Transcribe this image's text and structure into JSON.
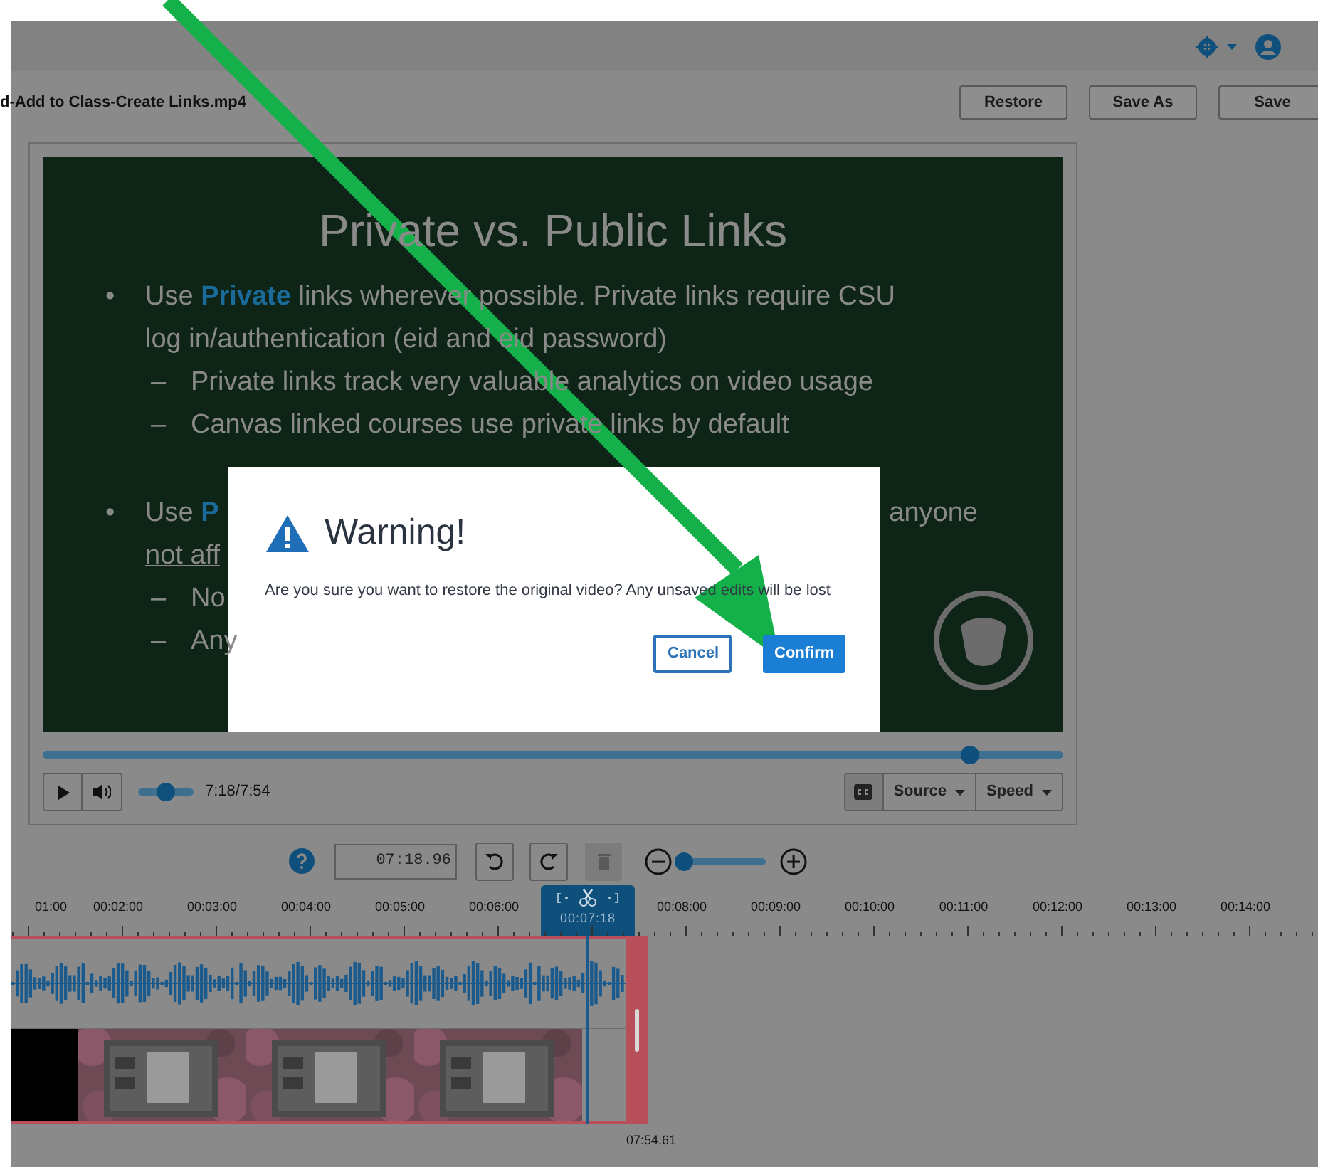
{
  "file": {
    "name": "d-Add to Class-Create Links.mp4"
  },
  "actions": [
    {
      "label": "Restore"
    },
    {
      "label": "Save As"
    },
    {
      "label": "Save"
    }
  ],
  "slide": {
    "title": "Private vs. Public Links",
    "bullets": [
      {
        "kind": "bullet",
        "marker": "•",
        "segments": [
          {
            "text": "Use "
          },
          {
            "text": "Private",
            "highlight": true
          },
          {
            "text": " links wherever possible. Private links require CSU log in/authentication (eid and eid password)"
          }
        ]
      },
      {
        "kind": "dash",
        "marker": "–",
        "segments": [
          {
            "text": "Private links track very valuable analytics on video usage"
          }
        ]
      },
      {
        "kind": "dash",
        "marker": "–",
        "segments": [
          {
            "text": "Canvas linked courses use private links by default"
          }
        ]
      },
      {
        "kind": "gap"
      },
      {
        "kind": "bullet",
        "marker": "•",
        "segments": [
          {
            "text": "Use "
          },
          {
            "text": "P",
            "highlight": true
          }
        ],
        "trailing": "anyone"
      },
      {
        "kind": "continuation",
        "segments": [
          {
            "text": "not aff",
            "underline": true
          }
        ]
      },
      {
        "kind": "dash",
        "marker": "–",
        "segments": [
          {
            "text": "No"
          }
        ]
      },
      {
        "kind": "dash",
        "marker": "–",
        "segments": [
          {
            "text": "Any"
          }
        ]
      }
    ]
  },
  "player": {
    "progress": {
      "level": 0.916
    },
    "volume": {
      "level": 0.5
    },
    "time": "7:18/7:54",
    "source": "Source",
    "speed": "Speed"
  },
  "toolbar": {
    "time_value": "07:18.96",
    "zoom": {
      "level": 0
    }
  },
  "timeline": {
    "ticks": [
      {
        "kind": "tick",
        "label": "01:00"
      },
      {
        "kind": "tick",
        "label": "00:02:00"
      },
      {
        "kind": "tick",
        "label": "00:03:00"
      },
      {
        "kind": "tick",
        "label": "00:04:00"
      },
      {
        "kind": "tick",
        "label": "00:05:00"
      },
      {
        "kind": "tick",
        "label": "00:06:00"
      },
      {
        "kind": "playhead",
        "label": "00:07:18"
      },
      {
        "kind": "tick",
        "label": "00:08:00"
      },
      {
        "kind": "tick",
        "label": "00:09:00"
      },
      {
        "kind": "tick",
        "label": "00:10:00"
      },
      {
        "kind": "tick",
        "label": "00:11:00"
      },
      {
        "kind": "tick",
        "label": "00:12:00"
      },
      {
        "kind": "tick",
        "label": "00:13:00"
      },
      {
        "kind": "tick",
        "label": "00:14:00"
      }
    ],
    "end_time": "07:54.61"
  },
  "dialog": {
    "title": "Warning!",
    "message": "Are you sure you want to restore the original video? Any unsaved edits will be lost",
    "buttons": [
      {
        "kind": "secondary",
        "label": "Cancel"
      },
      {
        "kind": "primary",
        "label": "Confirm"
      }
    ]
  }
}
